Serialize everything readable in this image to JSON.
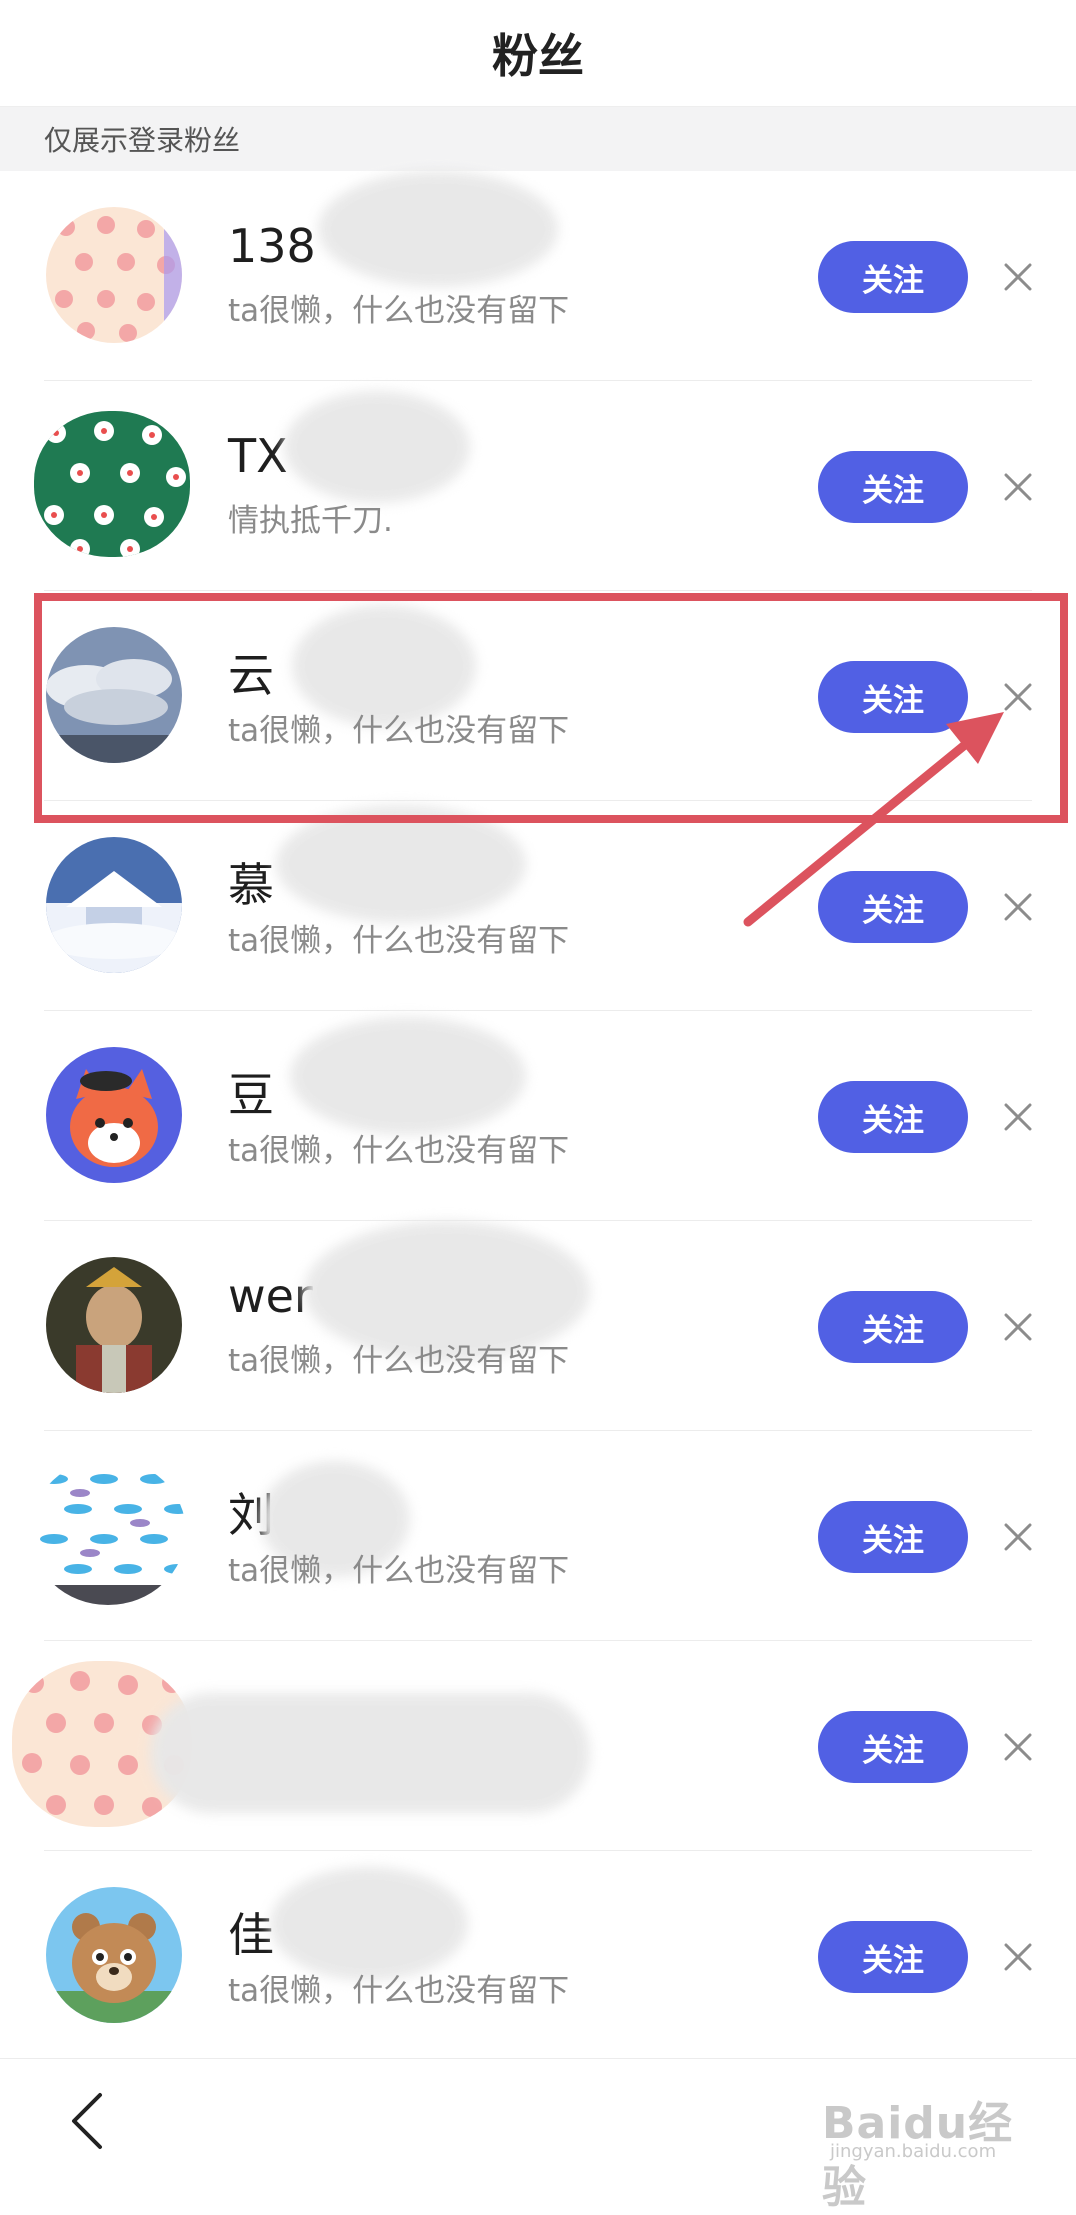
{
  "header": {
    "title": "粉丝"
  },
  "notice": {
    "text": "仅展示登录粉丝"
  },
  "follow_label": "关注",
  "accent_color": "#5160e4",
  "highlight_color": "#dc535e",
  "fans": [
    {
      "name": "138",
      "bio": "ta很懒，什么也没有留下",
      "avatar": "pig-pattern-avatar"
    },
    {
      "name": "TX",
      "bio": "情执抵千刀.",
      "avatar": "flower-pattern-avatar"
    },
    {
      "name": "云",
      "bio": "ta很懒，什么也没有留下",
      "avatar": "cloud-sky-avatar"
    },
    {
      "name": "慕",
      "bio": "ta很懒，什么也没有留下",
      "avatar": "snow-house-avatar"
    },
    {
      "name": "豆",
      "bio": "ta很懒，什么也没有留下",
      "avatar": "fox-cartoon-avatar"
    },
    {
      "name": "wer",
      "bio": "ta很懒，什么也没有留下",
      "avatar": "old-man-photo-avatar"
    },
    {
      "name": "刘",
      "bio": "ta很懒，什么也没有留下",
      "avatar": "fish-pattern-avatar"
    },
    {
      "name": "",
      "bio": "",
      "avatar": "pig-pattern-avatar"
    },
    {
      "name": "佳",
      "bio": "ta很懒，什么也没有留下",
      "avatar": "bear-cartoon-avatar"
    }
  ],
  "watermark": {
    "brand": "Baidu经验",
    "url": "jingyan.baidu.com"
  }
}
